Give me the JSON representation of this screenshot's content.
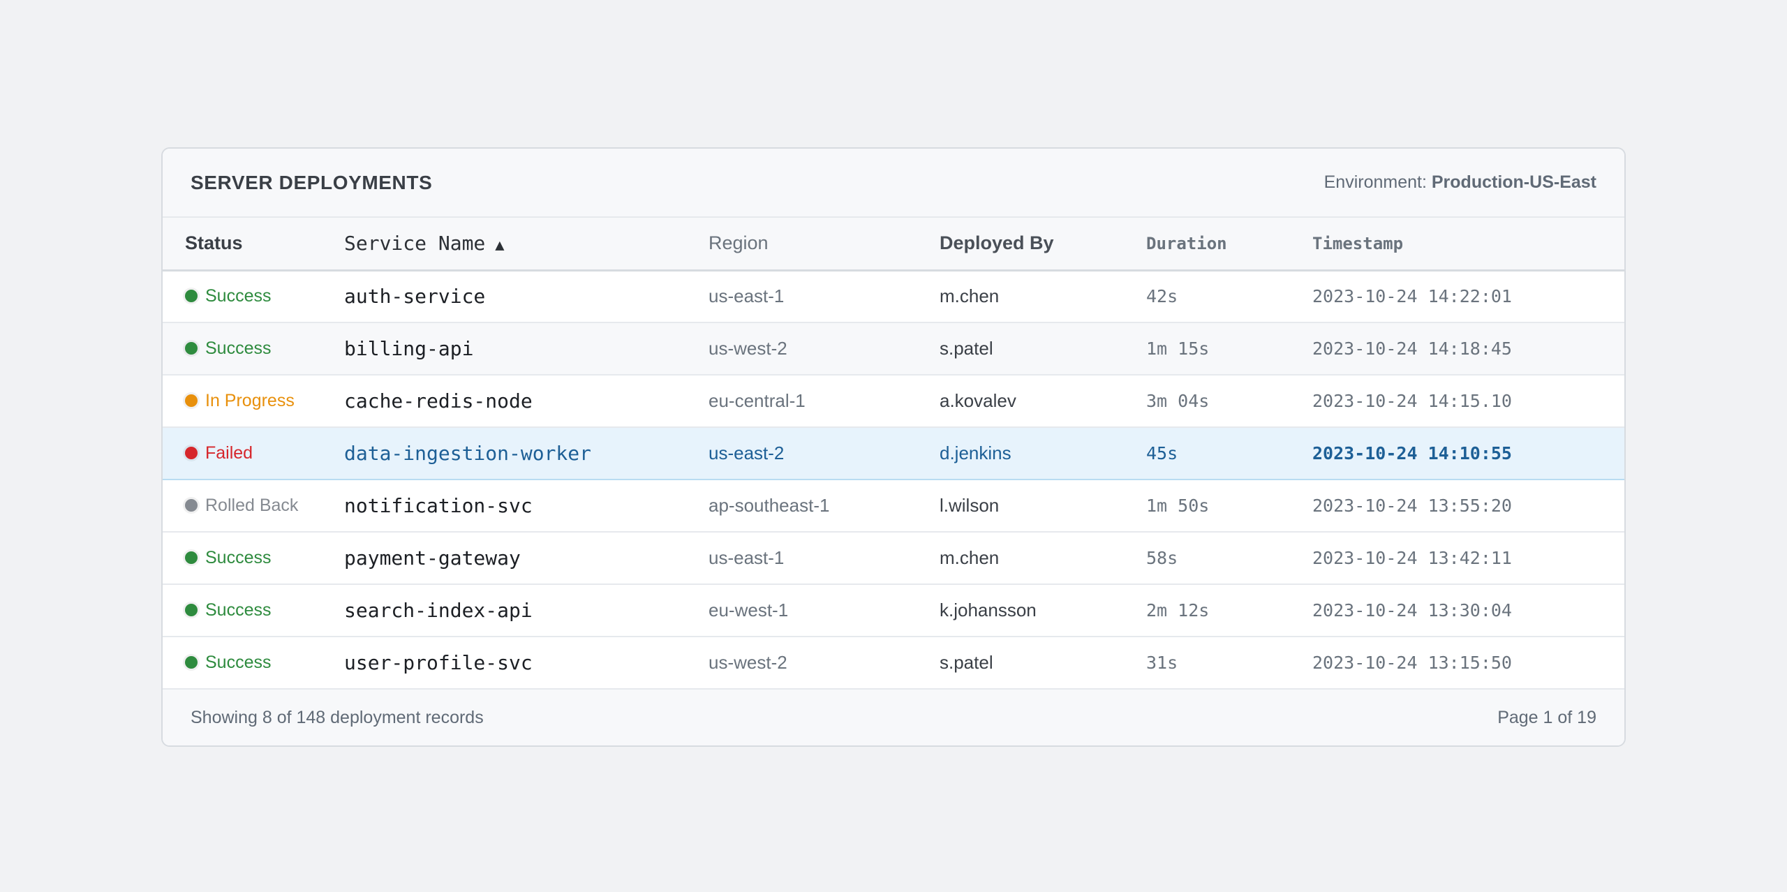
{
  "header": {
    "title": "SERVER DEPLOYMENTS",
    "environment_label": "Environment:",
    "environment_value": "Production-US-East"
  },
  "table": {
    "columns": {
      "status": "Status",
      "service": "Service Name",
      "sort_indicator": "▲",
      "region": "Region",
      "deployed_by": "Deployed By",
      "duration": "Duration",
      "timestamp": "Timestamp"
    },
    "rows": [
      {
        "status": "Success",
        "status_color": "#2e8b3e",
        "service": "auth-service",
        "region": "us-east-1",
        "deployed_by": "m.chen",
        "duration": "42s",
        "timestamp": "2023-10-24 14:22:01"
      },
      {
        "status": "Success",
        "status_color": "#2e8b3e",
        "service": "billing-api",
        "region": "us-west-2",
        "deployed_by": "s.patel",
        "duration": "1m 15s",
        "timestamp": "2023-10-24 14:18:45"
      },
      {
        "status": "In Progress",
        "status_color": "#e8900c",
        "service": "cache-redis-node",
        "region": "eu-central-1",
        "deployed_by": "a.kovalev",
        "duration": "3m 04s",
        "timestamp": "2023-10-24 14:15.10"
      },
      {
        "status": "Failed",
        "status_color": "#d6262b",
        "service": "data-ingestion-worker",
        "region": "us-east-2",
        "deployed_by": "d.jenkins",
        "duration": "45s",
        "timestamp": "2023-10-24 14:10:55"
      },
      {
        "status": "Rolled Back",
        "status_color": "#858a91",
        "service": "notification-svc",
        "region": "ap-southeast-1",
        "deployed_by": "l.wilson",
        "duration": "1m 50s",
        "timestamp": "2023-10-24 13:55:20"
      },
      {
        "status": "Success",
        "status_color": "#2e8b3e",
        "service": "payment-gateway",
        "region": "us-east-1",
        "deployed_by": "m.chen",
        "duration": "58s",
        "timestamp": "2023-10-24 13:42:11"
      },
      {
        "status": "Success",
        "status_color": "#2e8b3e",
        "service": "search-index-api",
        "region": "eu-west-1",
        "deployed_by": "k.johansson",
        "duration": "2m 12s",
        "timestamp": "2023-10-24 13:30:04"
      },
      {
        "status": "Success",
        "status_color": "#2e8b3e",
        "service": "user-profile-svc",
        "region": "us-west-2",
        "deployed_by": "s.patel",
        "duration": "31s",
        "timestamp": "2023-10-24 13:15:50"
      }
    ]
  },
  "footer": {
    "summary": "Showing 8 of 148 deployment records",
    "pagination": "Page 1 of 19"
  },
  "colors": {
    "success": "#2e8b3e",
    "in_progress": "#e8900c",
    "failed": "#d6262b",
    "rolled_back": "#858a91",
    "selected_row_bg": "#e7f3fc",
    "selected_row_text": "#1d5f96"
  }
}
